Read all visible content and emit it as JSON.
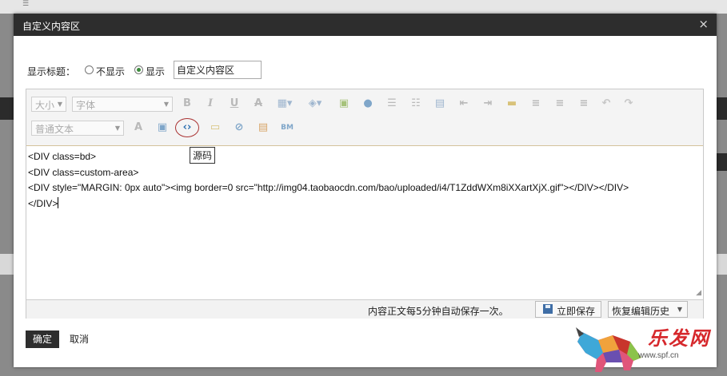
{
  "dialog": {
    "title": "自定义内容区",
    "close_glyph": "×"
  },
  "title_row": {
    "label": "显示标题：",
    "option_hide": "不显示",
    "option_show": "显示",
    "selected": "显示",
    "title_value": "自定义内容区"
  },
  "toolbar": {
    "font_size_placeholder": "大小",
    "font_family_placeholder": "字体",
    "paragraph_placeholder": "普通文本",
    "source_tooltip": "源码"
  },
  "code_lines": [
    "<DIV class=bd>",
    "<DIV class=custom-area>",
    "<DIV style=\"MARGIN: 0px auto\"><img border=0 src=\"http://img04.taobaocdn.com/bao/uploaded/i4/T1ZddWXm8iXXartXjX.gif\"></DIV></DIV>",
    "</DIV>"
  ],
  "status_bar": {
    "autosave_text": "内容正文每5分钟自动保存一次。",
    "save_now_label": "立即保存",
    "restore_history_label": "恢复编辑历史"
  },
  "footer": {
    "ok_label": "确定",
    "cancel_label": "取消"
  },
  "watermark": {
    "brand": "乐发网",
    "url": "www.spf.cn"
  },
  "colors": {
    "titlebar": "#2d2d2d",
    "ok_button": "#2e2e2e",
    "watermark_red": "#d6282c"
  }
}
